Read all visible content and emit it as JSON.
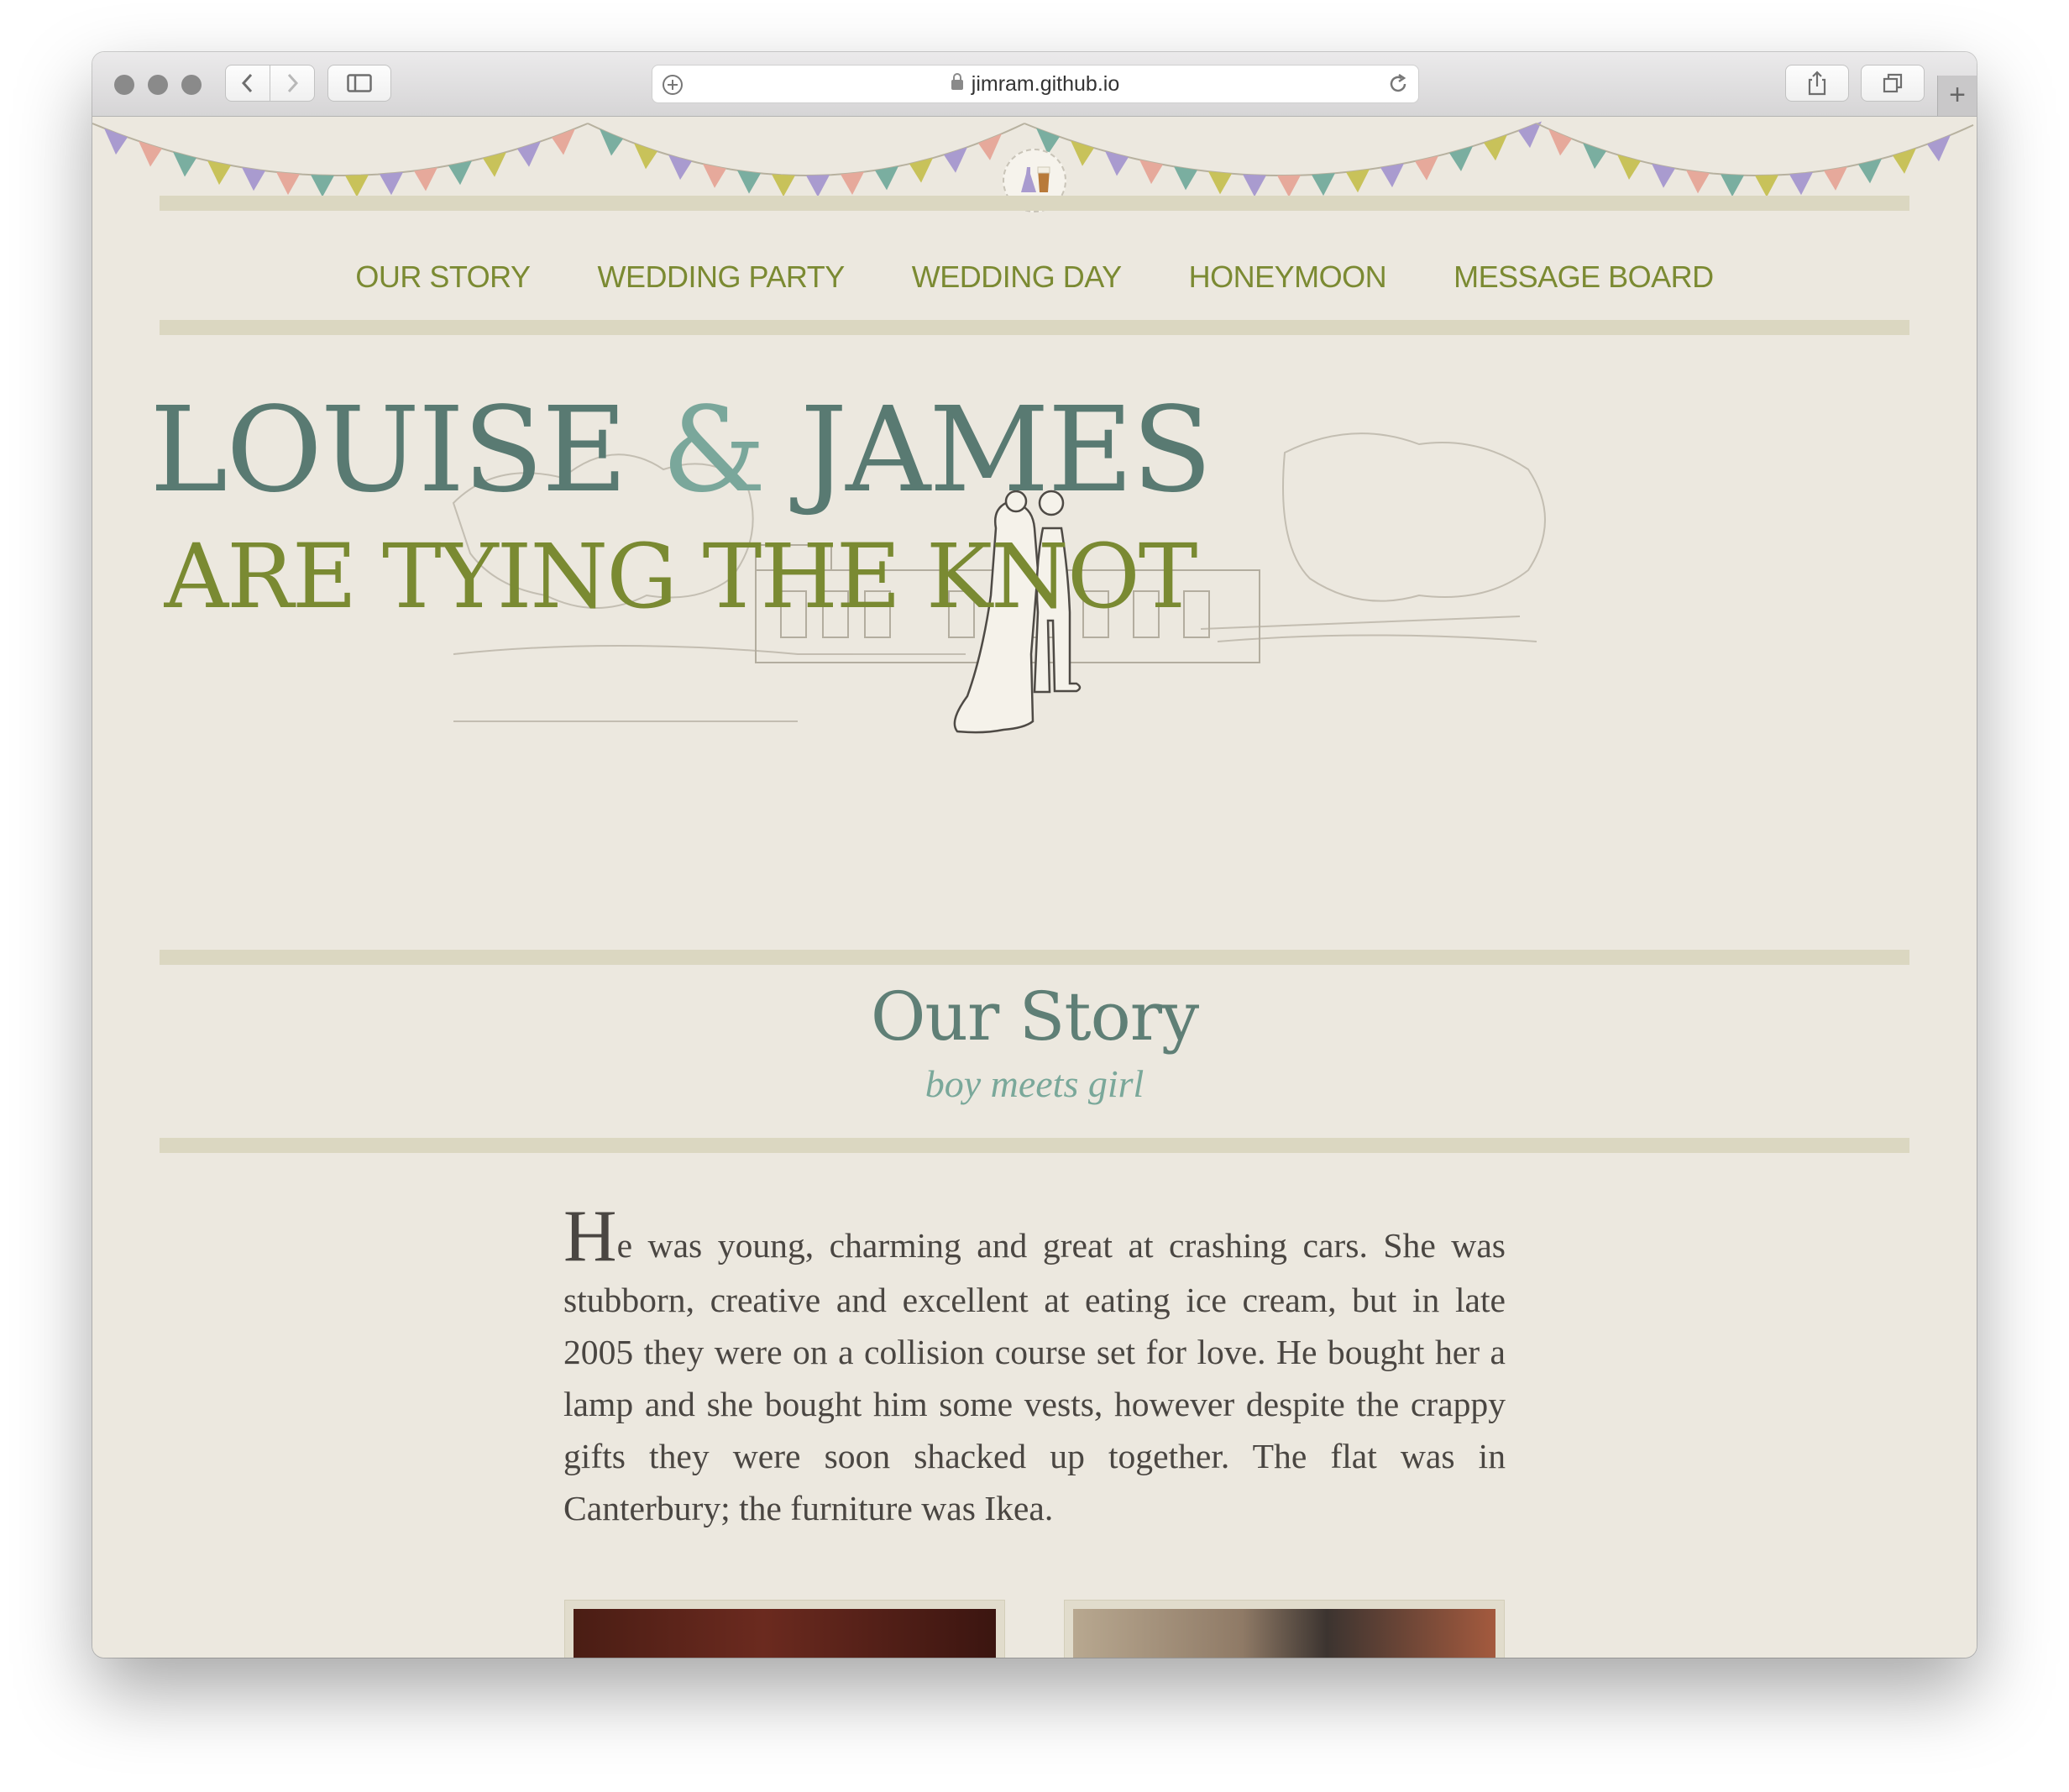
{
  "browser": {
    "url": "jimram.github.io",
    "new_tab": "+"
  },
  "nav": {
    "items": [
      "OUR STORY",
      "WEDDING PARTY",
      "WEDDING DAY",
      "HONEYMOON",
      "MESSAGE BOARD"
    ]
  },
  "hero": {
    "name1": "LOUISE",
    "ampersand": "&",
    "name2": "JAMES",
    "tagline": "ARE TYING THE KNOT"
  },
  "section": {
    "title": "Our Story",
    "subtitle": "boy meets girl",
    "dropcap": "H",
    "body": "e was young, charming and great at crashing cars. She was stubborn, creative and excellent at eating ice cream, but in late 2005 they were on a collision course set for love. He bought her a lamp and she bought him some vests, however despite the crappy gifts they were soon shacked up together. The flat was in Canterbury; the furniture was Ikea."
  },
  "colors": {
    "background": "#ece8df",
    "nav_text": "#7b8a32",
    "names": "#597a72",
    "ampersand": "#7aa79b",
    "tagline": "#7a8a32",
    "divider": "#dbd7c1",
    "flags": [
      "#a99bcf",
      "#e6a99b",
      "#7aaea0",
      "#c8c25a"
    ]
  },
  "icons": [
    "back-icon",
    "forward-icon",
    "sidebar-icon",
    "add-icon",
    "lock-icon",
    "reload-icon",
    "share-icon",
    "tabs-icon"
  ]
}
